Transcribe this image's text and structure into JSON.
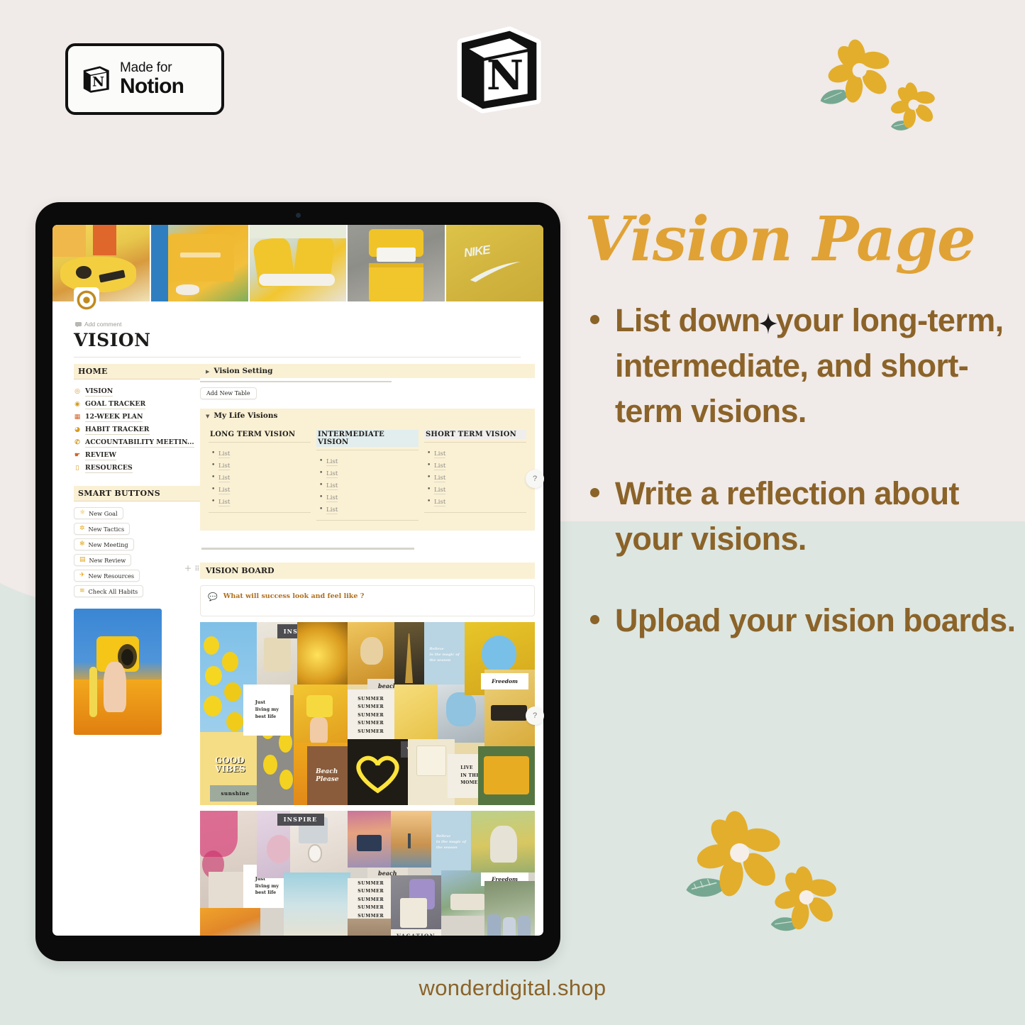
{
  "badge": {
    "made_label": "Made for",
    "brand_label": "Notion",
    "icon": "notion-cube-icon"
  },
  "brand_logo": {
    "icon": "notion-logo-icon"
  },
  "promo": {
    "headline": "Vision Page",
    "bullets": [
      {
        "before": "List down",
        "sparkle": "sparkle-icon",
        "after": "your long-term, intermediate, and short-term visions."
      },
      {
        "text": "Write a reflection about your visions."
      },
      {
        "text": "Upload your vision boards."
      }
    ],
    "footer_url": "wonderdigital.shop"
  },
  "colors": {
    "bg_pink": "#f0eae8",
    "bg_green": "#dde6e1",
    "accent_orange": "#e0a235",
    "text_brown": "#8b6329",
    "notion_band": "#faf0d4"
  },
  "tablet": {
    "cover_images": [
      "yellow-ukulele-photo",
      "yellow-dior-sweatshirt-photo",
      "yellow-converse-sneakers-photo",
      "yellow-two-piece-outfit-photo",
      "yellow-nike-hoodie-photo"
    ],
    "page": {
      "icon": "target-page-icon",
      "add_comment": "Add comment",
      "comment_icon": "comment-icon",
      "title": "VISION",
      "sidebar": {
        "home_header": "HOME",
        "nav_items": [
          {
            "label": "VISION",
            "icon": "eye-icon",
            "glyph": "◎"
          },
          {
            "label": "GOAL TRACKER",
            "icon": "target-icon",
            "glyph": "◉"
          },
          {
            "label": "12-WEEK PLAN",
            "icon": "calendar-icon",
            "glyph": "▦"
          },
          {
            "label": "HABIT TRACKER",
            "icon": "magnifier-icon",
            "glyph": "◕"
          },
          {
            "label": "ACCOUNTABILITY MEETIN...",
            "icon": "phone-icon",
            "glyph": "✆"
          },
          {
            "label": "REVIEW",
            "icon": "hand-icon",
            "glyph": "☛"
          },
          {
            "label": "RESOURCES",
            "icon": "bag-icon",
            "glyph": "▯"
          }
        ],
        "smart_header": "SMART BUTTONS",
        "smart_buttons": [
          {
            "label": "New Goal",
            "icon": "sun-icon",
            "glyph": "☼"
          },
          {
            "label": "New Tactics",
            "icon": "gear-flower-icon",
            "glyph": "✲"
          },
          {
            "label": "New Meeting",
            "icon": "clover-icon",
            "glyph": "✻"
          },
          {
            "label": "New Review",
            "icon": "briefcase-icon",
            "glyph": "▤"
          },
          {
            "label": "New Resources",
            "icon": "airplane-icon",
            "glyph": "✈"
          },
          {
            "label": "Check All Habits",
            "icon": "ladder-icon",
            "glyph": "≋"
          }
        ],
        "photo": "yellow-instax-camera-in-poppy-field-photo"
      },
      "main": {
        "vision_setting_title": "Vision Setting",
        "vision_setting_toggle": "collapsed",
        "add_table_button": "Add New Table",
        "life_visions_title": "My Life Visions",
        "life_visions_toggle": "expanded",
        "vision_columns": [
          {
            "header": "LONG TERM VISION",
            "highlight": "none",
            "items": [
              "List",
              "List",
              "List",
              "List",
              "List"
            ]
          },
          {
            "header": "INTERMEDIATE VISION",
            "highlight": "blue",
            "items": [
              "List",
              "List",
              "List",
              "List",
              "List"
            ]
          },
          {
            "header": "SHORT TERM VISION",
            "highlight": "grey",
            "items": [
              "List",
              "List",
              "List",
              "List",
              "List"
            ]
          }
        ],
        "vision_board_title": "VISION BOARD",
        "callout": {
          "icon": "speech-emoji-icon",
          "text": "What will success look and feel like ?"
        },
        "collage_one": {
          "name": "yellow-aesthetic-vision-board",
          "labels": [
            "INSPIRE",
            "Just living my best life",
            "beach",
            "SUMMER SUMMER SUMMER SUMMER SUMMER",
            "Believe in the magic of the season",
            "Freedom",
            "GOOD VIBES",
            "Beach Please",
            "VACATION",
            "LIVE IN THE MOMENT",
            "sunshine"
          ]
        },
        "collage_two": {
          "name": "pastel-travel-vision-board",
          "labels": [
            "INSPIRE",
            "Just living my best life",
            "beach",
            "SUMMER SUMMER SUMMER SUMMER SUMMER",
            "Believe in the magic of the season",
            "Freedom",
            "VACATION"
          ]
        }
      }
    },
    "help_bubbles": [
      "?",
      "?"
    ]
  }
}
